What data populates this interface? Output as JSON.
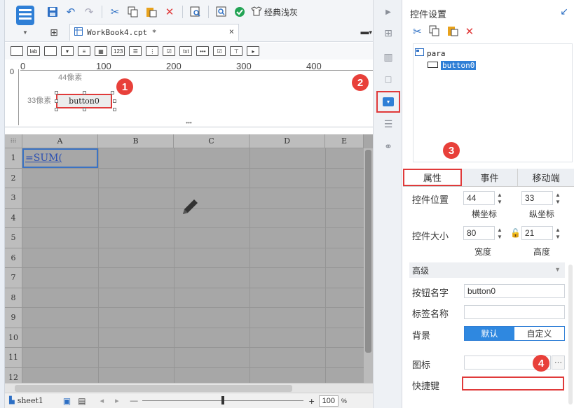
{
  "toolbar": {
    "theme_label": "经典浅灰",
    "icons": [
      "save-icon",
      "undo-icon",
      "redo-icon",
      "cut-icon",
      "copy-icon",
      "paste-icon",
      "delete-icon",
      "preview-icon",
      "search-icon",
      "check-icon",
      "theme-icon"
    ]
  },
  "tabs": {
    "file_name": "WorkBook4.cpt *",
    "close": "×",
    "menu": "▾"
  },
  "widgets": {
    "label_icon": "lab",
    "number_icon": "123",
    "text_icon": "txt"
  },
  "ruler": {
    "marks": [
      "0",
      "100",
      "200",
      "300",
      "400"
    ],
    "left_mark": "0",
    "x_px_label": "44像素",
    "y_px_label": "33像素"
  },
  "design": {
    "button_label": "button0",
    "splitter": "•••"
  },
  "badges": [
    "1",
    "2",
    "3",
    "4"
  ],
  "sheet": {
    "columns": [
      "A",
      "B",
      "C",
      "D",
      "E"
    ],
    "rows": [
      "1",
      "2",
      "3",
      "4",
      "5",
      "6",
      "7",
      "8",
      "9",
      "10",
      "11",
      "12"
    ],
    "a1_value": "=SUM(",
    "corner": "⁝⁝⁝"
  },
  "statusbar": {
    "sheet_name": "sheet1",
    "zoom": "100",
    "zoom_unit": "%",
    "minus": "—",
    "plus": "+"
  },
  "panel": {
    "title": "控件设置",
    "tree_root": "para",
    "tree_child": "button0",
    "tabs": [
      "属性",
      "事件",
      "移动端"
    ],
    "position_label": "控件位置",
    "pos_x": "44",
    "pos_y": "33",
    "pos_x_label": "横坐标",
    "pos_y_label": "纵坐标",
    "size_label": "控件大小",
    "width": "80",
    "height": "21",
    "width_label": "宽度",
    "height_label": "高度",
    "advanced_label": "高级",
    "button_name_label": "按钮名字",
    "button_name_value": "button0",
    "tag_name_label": "标签名称",
    "tag_name_value": "",
    "background_label": "背景",
    "bg_default": "默认",
    "bg_custom": "自定义",
    "icon_label": "图标",
    "icon_more": "···",
    "shortcut_label": "快捷键",
    "shortcut_value": ""
  },
  "colors": {
    "accent": "#2f7fd6",
    "highlight_red": "#e03a3a",
    "sheet_bg": "#a7a7a7"
  }
}
